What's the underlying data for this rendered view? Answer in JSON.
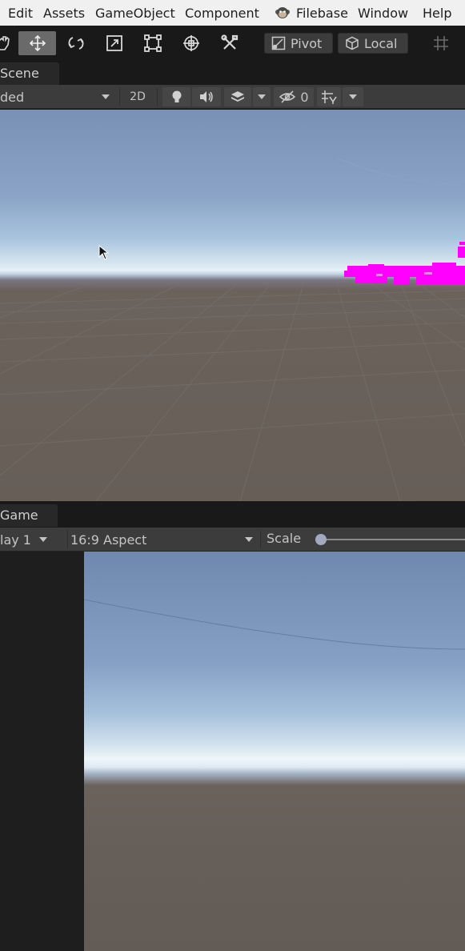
{
  "menu": {
    "items": [
      "Edit",
      "Assets",
      "GameObject",
      "Component",
      "Filebase",
      "Window",
      "Help"
    ]
  },
  "toolbar": {
    "tools": [
      {
        "name": "hand-tool",
        "icon": "hand-icon"
      },
      {
        "name": "move-tool",
        "icon": "move-arrows-icon",
        "active": true
      },
      {
        "name": "rotate-tool",
        "icon": "rotate-icon"
      },
      {
        "name": "scale-tool",
        "icon": "scale-icon"
      },
      {
        "name": "rect-tool",
        "icon": "rect-transform-icon"
      },
      {
        "name": "transform-tool",
        "icon": "transform-icon"
      },
      {
        "name": "custom-tool",
        "icon": "tools-icon"
      }
    ],
    "pivot_label": "Pivot",
    "local_label": "Local"
  },
  "scene": {
    "tab_label": "Scene",
    "shading_mode": "ded",
    "mode_2d": "2D",
    "hidden_count": "0"
  },
  "game": {
    "tab_label": "Game",
    "display": "lay 1",
    "aspect": "16:9 Aspect",
    "scale_label": "Scale"
  },
  "colors": {
    "menu_bg": "#f0f0f0",
    "toolbar_bg": "#191919",
    "panel_bar": "#3c3c3c",
    "missing_material": "#ff00ff"
  }
}
